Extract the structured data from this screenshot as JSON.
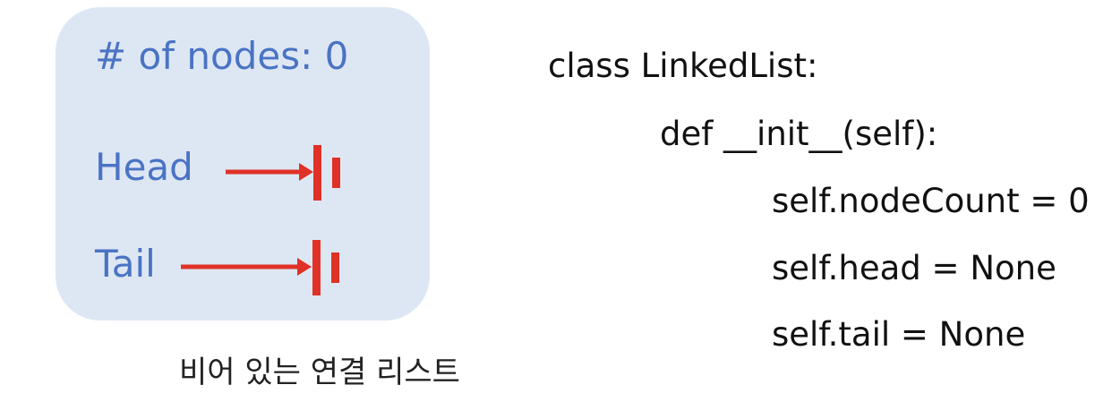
{
  "diagram": {
    "node_count_label": "# of nodes: 0",
    "head_label": "Head",
    "tail_label": "Tail",
    "caption": "비어 있는 연결 리스트",
    "colors": {
      "box_background": "#dde7f3",
      "label_text": "#4a73c4",
      "arrow": "#e03127"
    }
  },
  "code": {
    "lines": [
      "class LinkedList:",
      "def __init__(self):",
      "self.nodeCount = 0",
      "self.head = None",
      "self.tail = None"
    ]
  }
}
